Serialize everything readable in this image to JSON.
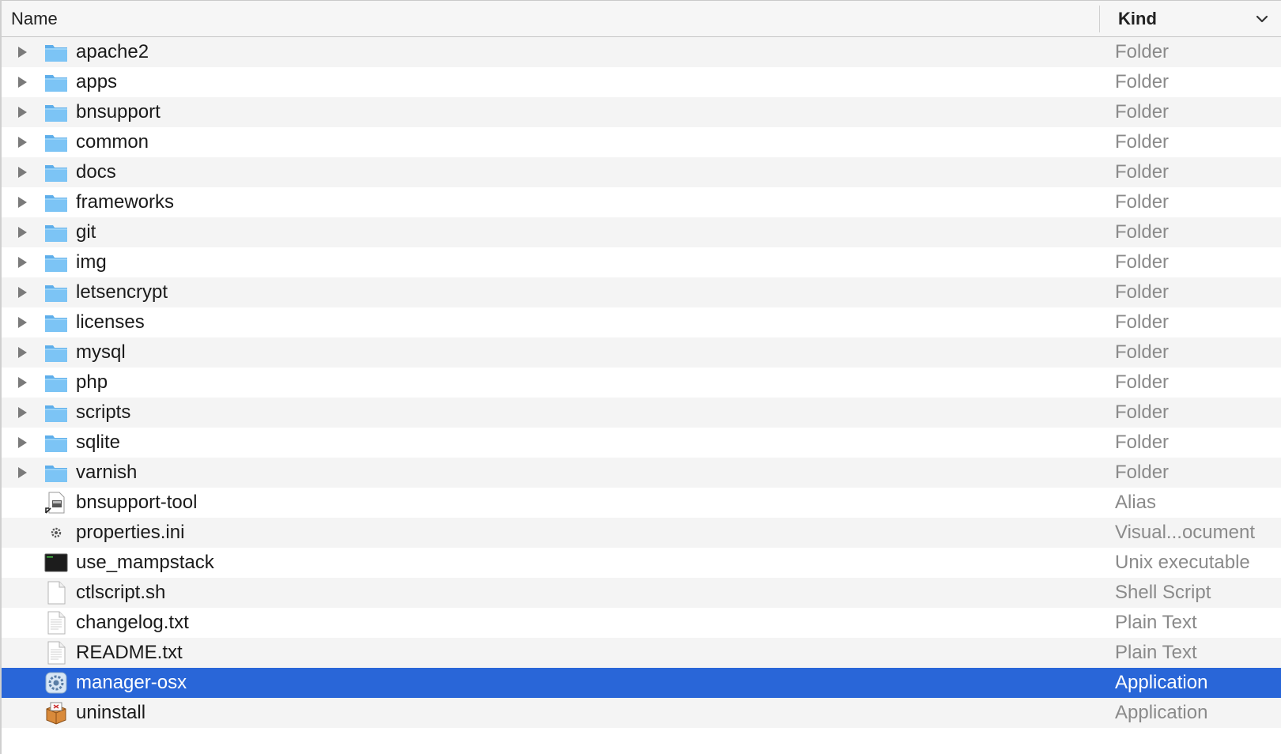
{
  "header": {
    "name_label": "Name",
    "kind_label": "Kind",
    "sort_icon": "chevron-down-icon"
  },
  "colors": {
    "selection": "#2966d8",
    "folder": "#6bbcf0",
    "kind_text": "#8a8a8a"
  },
  "files": [
    {
      "name": "apache2",
      "kind": "Folder",
      "icon": "folder-icon",
      "expandable": true,
      "selected": false
    },
    {
      "name": "apps",
      "kind": "Folder",
      "icon": "folder-icon",
      "expandable": true,
      "selected": false
    },
    {
      "name": "bnsupport",
      "kind": "Folder",
      "icon": "folder-icon",
      "expandable": true,
      "selected": false
    },
    {
      "name": "common",
      "kind": "Folder",
      "icon": "folder-icon",
      "expandable": true,
      "selected": false
    },
    {
      "name": "docs",
      "kind": "Folder",
      "icon": "folder-icon",
      "expandable": true,
      "selected": false
    },
    {
      "name": "frameworks",
      "kind": "Folder",
      "icon": "folder-icon",
      "expandable": true,
      "selected": false
    },
    {
      "name": "git",
      "kind": "Folder",
      "icon": "folder-icon",
      "expandable": true,
      "selected": false
    },
    {
      "name": "img",
      "kind": "Folder",
      "icon": "folder-icon",
      "expandable": true,
      "selected": false
    },
    {
      "name": "letsencrypt",
      "kind": "Folder",
      "icon": "folder-icon",
      "expandable": true,
      "selected": false
    },
    {
      "name": "licenses",
      "kind": "Folder",
      "icon": "folder-icon",
      "expandable": true,
      "selected": false
    },
    {
      "name": "mysql",
      "kind": "Folder",
      "icon": "folder-icon",
      "expandable": true,
      "selected": false
    },
    {
      "name": "php",
      "kind": "Folder",
      "icon": "folder-icon",
      "expandable": true,
      "selected": false
    },
    {
      "name": "scripts",
      "kind": "Folder",
      "icon": "folder-icon",
      "expandable": true,
      "selected": false
    },
    {
      "name": "sqlite",
      "kind": "Folder",
      "icon": "folder-icon",
      "expandable": true,
      "selected": false
    },
    {
      "name": "varnish",
      "kind": "Folder",
      "icon": "folder-icon",
      "expandable": true,
      "selected": false
    },
    {
      "name": "bnsupport-tool",
      "kind": "Alias",
      "icon": "alias-icon",
      "expandable": false,
      "selected": false
    },
    {
      "name": "properties.ini",
      "kind": "Visual...ocument",
      "icon": "settings-document-icon",
      "expandable": false,
      "selected": false
    },
    {
      "name": "use_mampstack",
      "kind": "Unix executable",
      "icon": "terminal-icon",
      "expandable": false,
      "selected": false
    },
    {
      "name": "ctlscript.sh",
      "kind": "Shell Script",
      "icon": "blank-document-icon",
      "expandable": false,
      "selected": false
    },
    {
      "name": "changelog.txt",
      "kind": "Plain Text",
      "icon": "text-document-icon",
      "expandable": false,
      "selected": false
    },
    {
      "name": "README.txt",
      "kind": "Plain Text",
      "icon": "text-document-icon",
      "expandable": false,
      "selected": false
    },
    {
      "name": "manager-osx",
      "kind": "Application",
      "icon": "gear-app-icon",
      "expandable": false,
      "selected": true
    },
    {
      "name": "uninstall",
      "kind": "Application",
      "icon": "box-app-icon",
      "expandable": false,
      "selected": false
    }
  ]
}
